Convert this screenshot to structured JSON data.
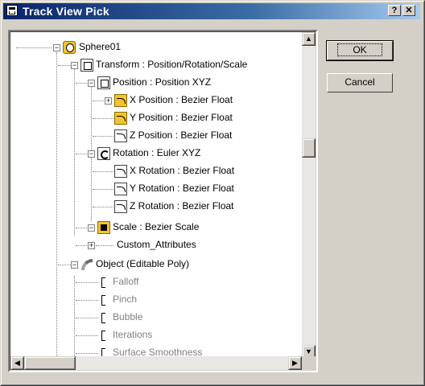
{
  "window": {
    "title": "Track View Pick",
    "help_label": "?",
    "close_label": "✕"
  },
  "buttons": {
    "ok": "OK",
    "cancel": "Cancel"
  },
  "tree": {
    "sphere": "Sphere01",
    "transform": "Transform : Position/Rotation/Scale",
    "position": "Position : Position XYZ",
    "x_position": "X Position : Bezier Float",
    "y_position": "Y Position : Bezier Float",
    "z_position": "Z Position : Bezier Float",
    "rotation": "Rotation : Euler XYZ",
    "x_rotation": "X Rotation : Bezier Float",
    "y_rotation": "Y Rotation : Bezier Float",
    "z_rotation": "Z Rotation : Bezier Float",
    "scale": "Scale : Bezier Scale",
    "custom_attributes": "Custom_Attributes",
    "object": "Object (Editable Poly)",
    "falloff": "Falloff",
    "pinch": "Pinch",
    "bubble": "Bubble",
    "iterations": "Iterations",
    "surface_smoothness": "Surface Smoothness"
  },
  "scrollbar": {
    "up_arrow": "▲",
    "down_arrow": "▼",
    "left_arrow": "◀",
    "right_arrow": "▶"
  },
  "colors": {
    "titlebar_start": "#0a246a",
    "titlebar_end": "#a6caf0",
    "highlight_icon": "#f4c430",
    "face": "#d4d0c8"
  }
}
